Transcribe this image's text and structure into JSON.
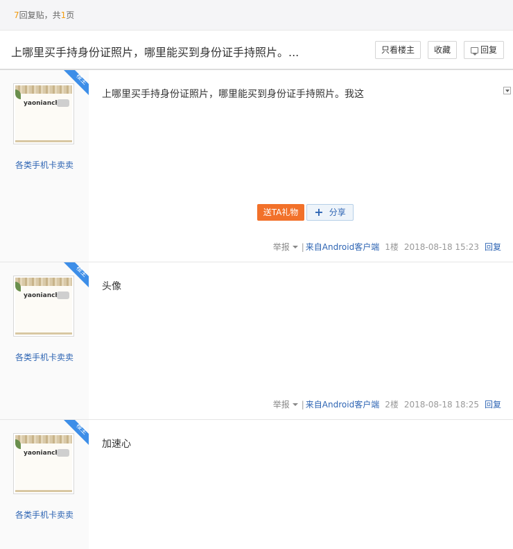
{
  "topbar": {
    "reply_num": "7",
    "reply_text": "回复贴，共",
    "page_num": "1",
    "page_suffix": "页"
  },
  "thread": {
    "title": "上哪里买手持身份证照片，哪里能买到身份证手持照片。...",
    "only_op_label": "只看楼主",
    "fav_label": "收藏",
    "reply_label": "回复"
  },
  "colors": {
    "accent_orange": "#f2712a",
    "link_blue": "#2d64b3",
    "badge_blue": "#3d8ee8",
    "count_orange": "#f29b0f"
  },
  "posts": [
    {
      "avatar_name": "yaonianchen",
      "badge": "楼主",
      "username": "各类手机卡卖卖",
      "content": "上哪里买手持身份证照片，哪里能买到身份证手持照片。我这",
      "gift_label": "送TA礼物",
      "share_label": "分享",
      "report": "举报",
      "sep": "|",
      "client": "来自Android客户端",
      "floor": "1楼",
      "time": "2018-08-18 15:23",
      "reply": "回复"
    },
    {
      "avatar_name": "yaonianchen",
      "badge": "楼主",
      "username": "各类手机卡卖卖",
      "content": "头像",
      "report": "举报",
      "sep": "|",
      "client": "来自Android客户端",
      "floor": "2楼",
      "time": "2018-08-18 18:25",
      "reply": "回复"
    },
    {
      "avatar_name": "yaonianche",
      "badge": "楼主",
      "username": "各类手机卡卖卖",
      "content": "加速心"
    }
  ]
}
